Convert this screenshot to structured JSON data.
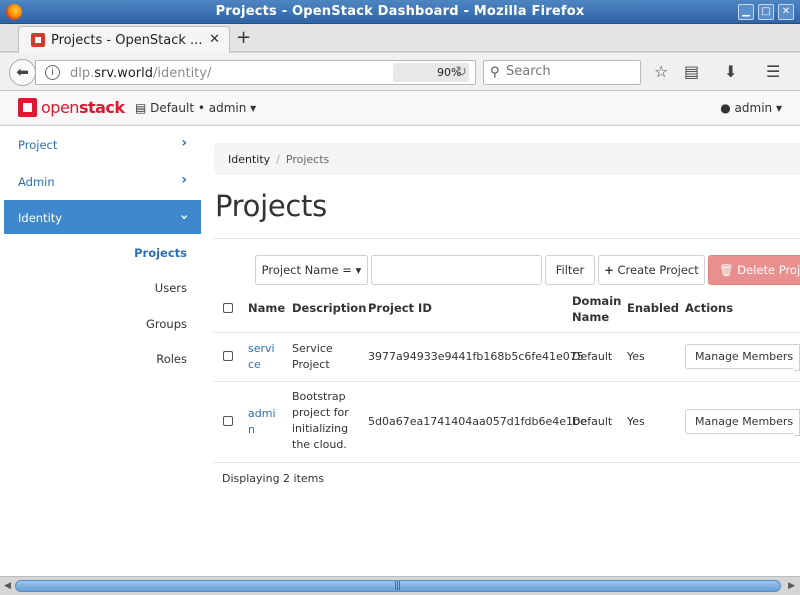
{
  "window": {
    "title": "Projects - OpenStack Dashboard - Mozilla Firefox",
    "btn_min": "▁",
    "btn_max": "□",
    "btn_close": "✕"
  },
  "browser": {
    "tab_label": "Projects - OpenStack ...",
    "tab_close": "✕",
    "new_tab": "+",
    "url_host_prefix": "dlp.",
    "url_host": "srv.world",
    "url_path": "/identity/",
    "zoom": "90%",
    "search_placeholder": "Search"
  },
  "app": {
    "logo_text_light": "open",
    "logo_text_bold": "stack",
    "project_selector": "Default • admin",
    "user_menu": "admin"
  },
  "sidebar": {
    "items": [
      {
        "label": "Project"
      },
      {
        "label": "Admin"
      },
      {
        "label": "Identity"
      }
    ],
    "sub_items": [
      {
        "label": "Projects"
      },
      {
        "label": "Users"
      },
      {
        "label": "Groups"
      },
      {
        "label": "Roles"
      }
    ]
  },
  "main": {
    "breadcrumb": {
      "root": "Identity",
      "sep": "/",
      "current": "Projects"
    },
    "title": "Projects",
    "toolbar": {
      "filter_select": "Project Name =",
      "filter_value": "",
      "filter_button": "Filter",
      "create_button": "Create Project",
      "delete_button": "Delete Projects"
    },
    "table": {
      "headers": {
        "name": "Name",
        "description": "Description",
        "project_id": "Project ID",
        "domain_name_1": "Domain",
        "domain_name_2": "Name",
        "enabled": "Enabled",
        "actions": "Actions"
      },
      "rows": [
        {
          "name_1": "servi",
          "name_2": "ce",
          "desc_1": "Service",
          "desc_2": "Project",
          "project_id": "3977a94933e9441fb168b5c6fe41e075",
          "domain": "Default",
          "enabled": "Yes",
          "action": "Manage Members"
        },
        {
          "name_1": "admi",
          "name_2": "n",
          "desc_1": "Bootstrap",
          "desc_2": "project for",
          "desc_3": "initializing",
          "desc_4": "the cloud.",
          "project_id": "5d0a67ea1741404aa057d1fdb6e4e1be",
          "domain": "Default",
          "enabled": "Yes",
          "action": "Manage Members"
        }
      ]
    },
    "footer": "Displaying 2 items"
  },
  "colors": {
    "accent": "#3f88cd",
    "link": "#2a6fb6",
    "danger": "#e8908d",
    "brand": "#da1a32"
  }
}
